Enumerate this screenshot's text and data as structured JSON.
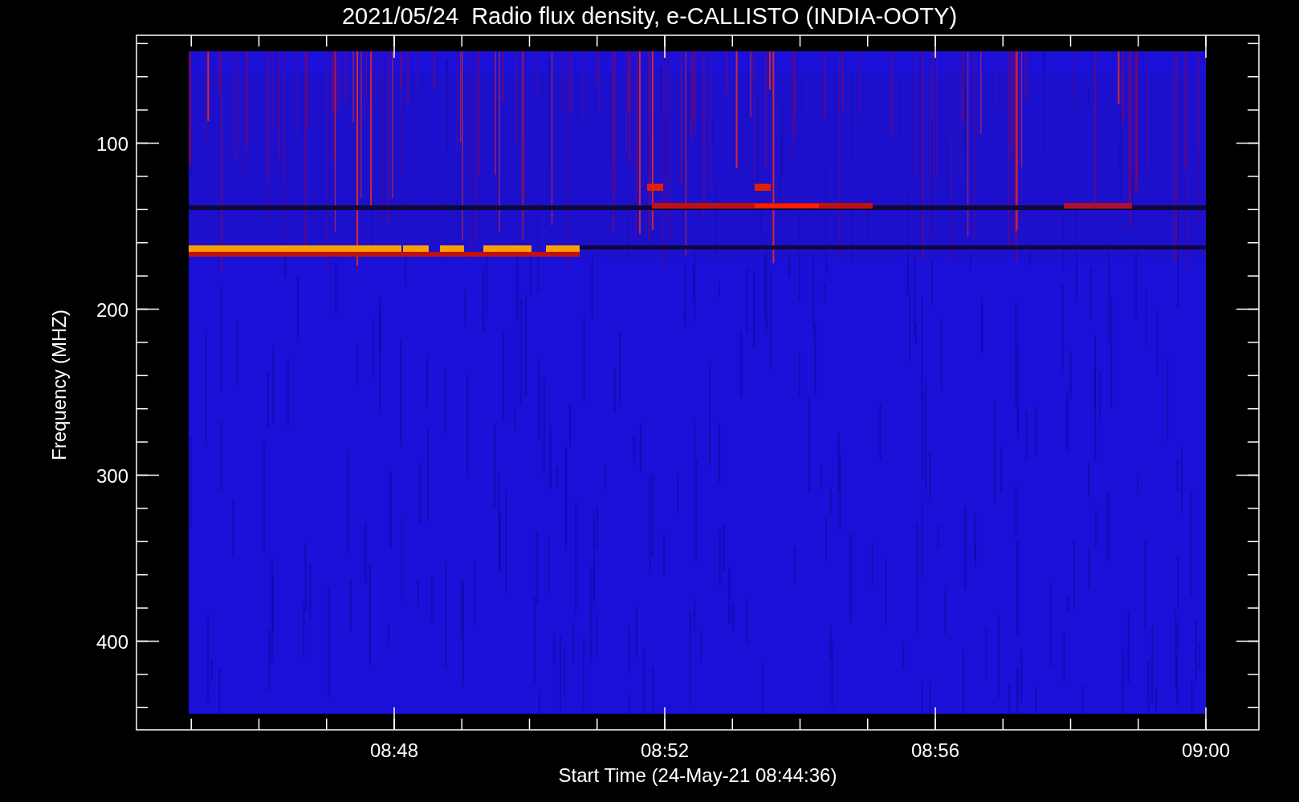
{
  "title": "2021/05/24  Radio flux density, e-CALLISTO (INDIA-OOTY)",
  "y_axis": {
    "label": "Frequency (MHZ)",
    "ticks": [
      "100",
      "200",
      "300",
      "400"
    ]
  },
  "x_axis": {
    "label": "Start Time (24-May-21 08:44:36)",
    "ticks": [
      "08:48",
      "08:52",
      "08:56",
      "09:00"
    ]
  }
}
